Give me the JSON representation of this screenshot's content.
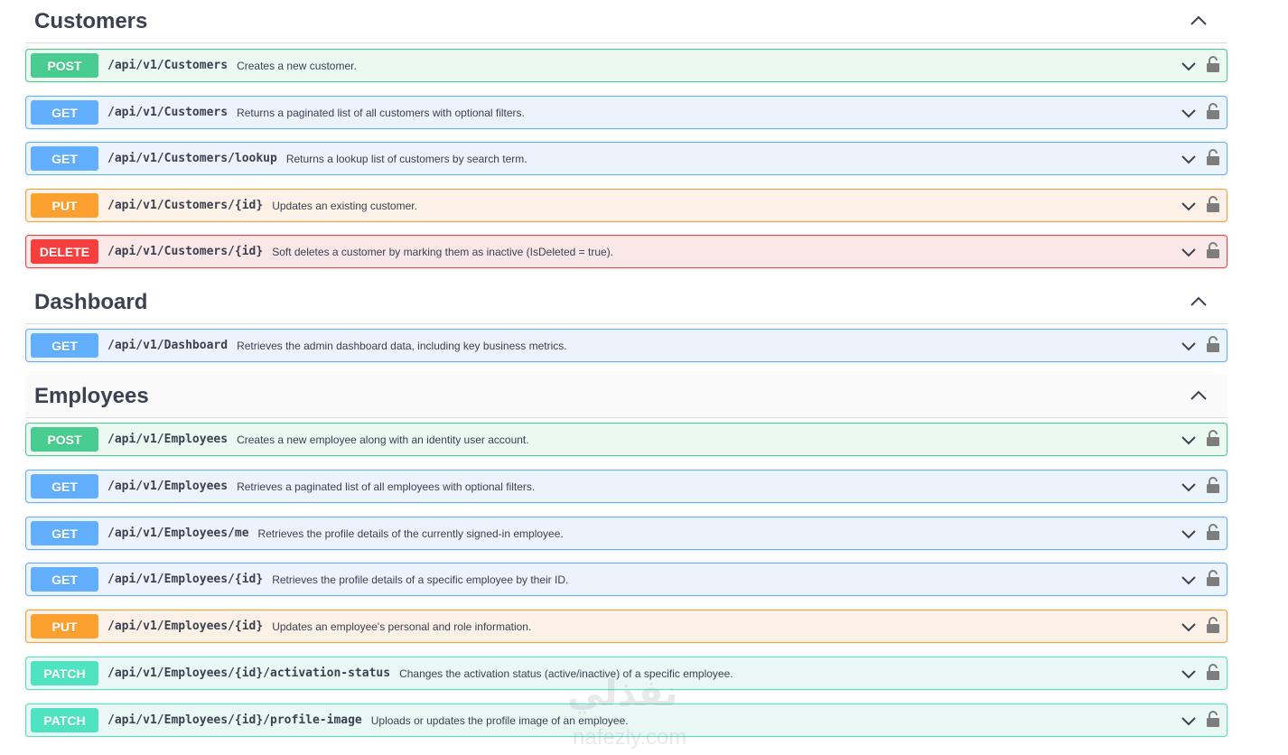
{
  "sections": [
    {
      "title": "Customers",
      "operations": [
        {
          "method": "POST",
          "path": "/api/v1/Customers",
          "summary": "Creates a new customer."
        },
        {
          "method": "GET",
          "path": "/api/v1/Customers",
          "summary": "Returns a paginated list of all customers with optional filters."
        },
        {
          "method": "GET",
          "path": "/api/v1/Customers/lookup",
          "summary": "Returns a lookup list of customers by search term."
        },
        {
          "method": "PUT",
          "path": "/api/v1/Customers/{id}",
          "summary": "Updates an existing customer."
        },
        {
          "method": "DELETE",
          "path": "/api/v1/Customers/{id}",
          "summary": "Soft deletes a customer by marking them as inactive (IsDeleted = true)."
        }
      ]
    },
    {
      "title": "Dashboard",
      "operations": [
        {
          "method": "GET",
          "path": "/api/v1/Dashboard",
          "summary": "Retrieves the admin dashboard data, including key business metrics."
        }
      ]
    },
    {
      "title": "Employees",
      "operations": [
        {
          "method": "POST",
          "path": "/api/v1/Employees",
          "summary": "Creates a new employee along with an identity user account."
        },
        {
          "method": "GET",
          "path": "/api/v1/Employees",
          "summary": "Retrieves a paginated list of all employees with optional filters."
        },
        {
          "method": "GET",
          "path": "/api/v1/Employees/me",
          "summary": "Retrieves the profile details of the currently signed-in employee."
        },
        {
          "method": "GET",
          "path": "/api/v1/Employees/{id}",
          "summary": "Retrieves the profile details of a specific employee by their ID."
        },
        {
          "method": "PUT",
          "path": "/api/v1/Employees/{id}",
          "summary": "Updates an employee's personal and role information."
        },
        {
          "method": "PATCH",
          "path": "/api/v1/Employees/{id}/activation-status",
          "summary": "Changes the activation status (active/inactive) of a specific employee."
        },
        {
          "method": "PATCH",
          "path": "/api/v1/Employees/{id}/profile-image",
          "summary": "Uploads or updates the profile image of an employee."
        }
      ]
    }
  ],
  "watermark": {
    "arabic": "نفذلي",
    "latin": "nafezly.com"
  },
  "colors": {
    "post": "#49cc90",
    "get": "#61affe",
    "put": "#fca130",
    "delete": "#f93e3e",
    "patch": "#50e3c2",
    "text": "#3b4151"
  }
}
